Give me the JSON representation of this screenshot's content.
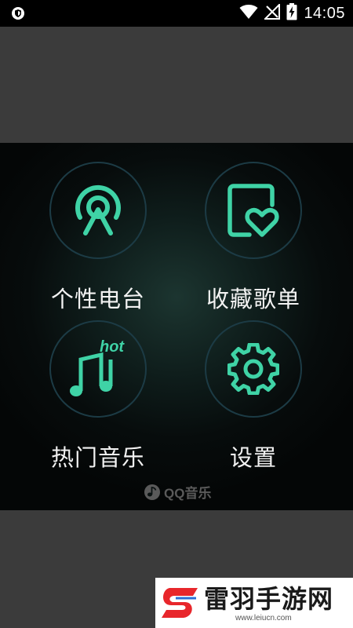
{
  "status_bar": {
    "time": "14:05",
    "icons": [
      "shield-icon",
      "wifi-icon",
      "no-signal-icon",
      "battery-charging-icon"
    ]
  },
  "menu": {
    "items": [
      {
        "label": "个性电台",
        "icon": "radio-antenna-icon"
      },
      {
        "label": "收藏歌单",
        "icon": "heart-playlist-icon"
      },
      {
        "label": "热门音乐",
        "icon": "music-note-hot-icon",
        "badge": "hot"
      },
      {
        "label": "设置",
        "icon": "gear-icon"
      }
    ]
  },
  "brand": {
    "logo_text": "QQ音乐"
  },
  "watermark": {
    "title": "雷羽手游网",
    "url": "www.leiucn.com"
  },
  "colors": {
    "accent": "#3fd3a6",
    "ring": "#1c3b45",
    "panel_bg": "#070c0c",
    "watermark_red": "#e8262b"
  }
}
